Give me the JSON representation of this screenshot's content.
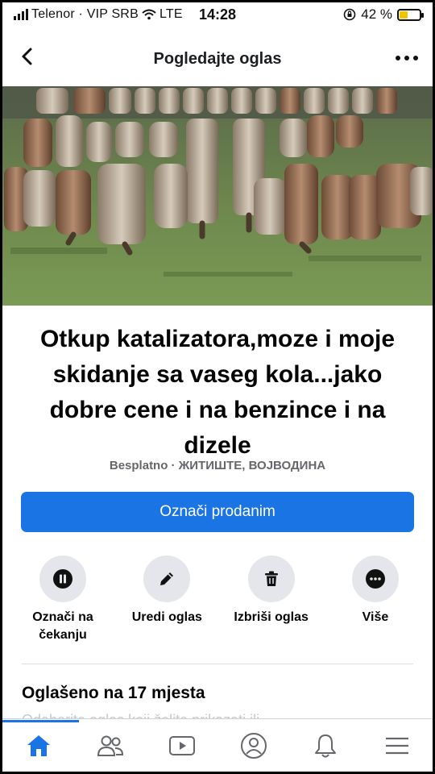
{
  "status_bar": {
    "carrier": "Telenor · VIP SRB",
    "network": "LTE",
    "time": "14:28",
    "battery": "42 %",
    "battery_level": 0.42
  },
  "header": {
    "title": "Pogledajte oglas"
  },
  "listing": {
    "title": "Otkup katalizatora,moze i moje skidanje sa vaseg kola...jako dobre cene i na benzince i na dizele",
    "meta": "Besplatno · ЖИТИШТЕ, ВОЈВОДИНА",
    "primary_button": "Označi prodanim"
  },
  "actions": [
    {
      "label": "Označi na čekanju",
      "icon": "pause-icon"
    },
    {
      "label": "Uredi oglas",
      "icon": "pencil-icon"
    },
    {
      "label": "Izbriši oglas",
      "icon": "trash-icon"
    },
    {
      "label": "Više",
      "icon": "more-icon"
    }
  ],
  "listed_section": {
    "title": "Oglašeno na 17 mjesta",
    "subtitle_partial": "Odaberite oglas koji želite prikazati ili"
  },
  "bottom_nav": [
    {
      "name": "home-icon",
      "active": true
    },
    {
      "name": "friends-icon",
      "active": false
    },
    {
      "name": "watch-icon",
      "active": false
    },
    {
      "name": "profile-icon",
      "active": false
    },
    {
      "name": "notifications-icon",
      "active": false
    },
    {
      "name": "menu-icon",
      "active": false
    }
  ],
  "colors": {
    "accent": "#1b74e4",
    "grey_button": "#e4e6eb",
    "meta_text": "#65676b"
  }
}
